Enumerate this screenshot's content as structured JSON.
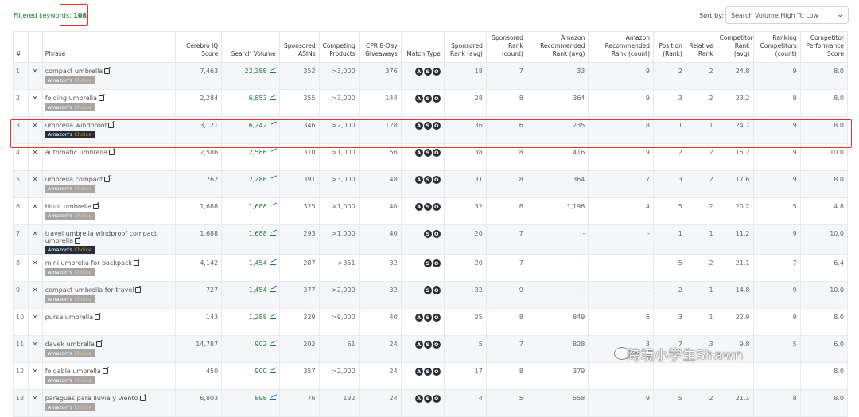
{
  "header": {
    "filtered_label": "Filtered keywords: ",
    "filtered_count": "108",
    "sort_label": "Sort by:",
    "sort_value": "Search Volume High To Low"
  },
  "columns": {
    "num": "#",
    "phrase": "Phrase",
    "cerebro": "Cerebro IQ Score",
    "search_volume": "Search Volume",
    "sponsored_asins": "Sponsored ASINs",
    "competing_products": "Competing Products",
    "cpr": "CPR 8-Day Giveaways",
    "match_type": "Match Type",
    "sponsored_rank_avg": "Sponsored Rank (avg)",
    "sponsored_rank_count": "Sponsored Rank (count)",
    "amazon_rec_rank_avg": "Amazon Recommended Rank (avg)",
    "amazon_rec_rank_count": "Amazon Recommended Rank (count)",
    "position": "Position (Rank)",
    "relative_rank": "Relative Rank",
    "competitor_rank_avg": "Competitor Rank (avg)",
    "ranking_competitors": "Ranking Competitors (count)",
    "competitor_perf": "Competitor Performance Score"
  },
  "badge": {
    "prefix": "Amazon's ",
    "suffix": "Choice"
  },
  "rows": [
    {
      "n": "1",
      "x": "✕",
      "phrase": "compact umbrella",
      "badge": "light",
      "cerebro": "7,463",
      "sv": "22,388",
      "sa": "352",
      "cp": ">3,000",
      "cpr": "376",
      "mt": [
        "A",
        "S",
        "O"
      ],
      "sra": "18",
      "src": "7",
      "ara": "33",
      "arc": "9",
      "pos": "2",
      "rel": "2",
      "cra": "24.8",
      "rc": "9",
      "cps": "8.0"
    },
    {
      "n": "2",
      "x": "✕",
      "phrase": "folding umbrella",
      "badge": "light",
      "cerebro": "2,284",
      "sv": "6,853",
      "sa": "355",
      "cp": ">3,000",
      "cpr": "144",
      "mt": [
        "A",
        "S",
        "O"
      ],
      "sra": "28",
      "src": "8",
      "ara": "364",
      "arc": "9",
      "pos": "3",
      "rel": "2",
      "cra": "23.2",
      "rc": "9",
      "cps": "8.0"
    },
    {
      "n": "3",
      "x": "✕",
      "phrase": "umbrella windproof",
      "badge": "dark",
      "cerebro": "3,121",
      "sv": "6,242",
      "sa": "346",
      "cp": ">2,000",
      "cpr": "128",
      "mt": [
        "A",
        "S",
        "O"
      ],
      "sra": "36",
      "src": "6",
      "ara": "235",
      "arc": "8",
      "pos": "1",
      "rel": "1",
      "cra": "24.7",
      "rc": "9",
      "cps": "8.0"
    },
    {
      "n": "4",
      "x": "✕",
      "phrase": "automatic umbrella",
      "badge": "",
      "cerebro": "2,586",
      "sv": "2,586",
      "sa": "310",
      "cp": ">1,000",
      "cpr": "56",
      "mt": [
        "A",
        "S",
        "O"
      ],
      "sra": "38",
      "src": "8",
      "ara": "416",
      "arc": "9",
      "pos": "2",
      "rel": "2",
      "cra": "15.2",
      "rc": "9",
      "cps": "10.0"
    },
    {
      "n": "5",
      "x": "✕",
      "phrase": "umbrella compact",
      "badge": "light",
      "cerebro": "762",
      "sv": "2,286",
      "sa": "391",
      "cp": ">3,000",
      "cpr": "48",
      "mt": [
        "A",
        "S",
        "O"
      ],
      "sra": "31",
      "src": "8",
      "ara": "364",
      "arc": "7",
      "pos": "3",
      "rel": "2",
      "cra": "17.6",
      "rc": "9",
      "cps": "8.0"
    },
    {
      "n": "6",
      "x": "✕",
      "phrase": "blunt umbrella",
      "badge": "light",
      "cerebro": "1,688",
      "sv": "1,688",
      "sa": "325",
      "cp": ">1,000",
      "cpr": "40",
      "mt": [
        "A",
        "S",
        "O"
      ],
      "sra": "32",
      "src": "6",
      "ara": "1,198",
      "arc": "4",
      "pos": "5",
      "rel": "2",
      "cra": "20.2",
      "rc": "5",
      "cps": "4.8"
    },
    {
      "n": "7",
      "x": "✕",
      "phrase": "travel umbrella windproof compact umbrella",
      "badge": "dark",
      "cerebro": "1,688",
      "sv": "1,688",
      "sa": "293",
      "cp": ">1,000",
      "cpr": "40",
      "mt": [
        "S",
        "O"
      ],
      "sra": "20",
      "src": "7",
      "ara": "-",
      "arc": "-",
      "pos": "1",
      "rel": "1",
      "cra": "11.2",
      "rc": "9",
      "cps": "10.0"
    },
    {
      "n": "8",
      "x": "✕",
      "phrase": "mini umbrella for backpack",
      "badge": "light",
      "cerebro": "4,142",
      "sv": "1,454",
      "sa": "287",
      "cp": ">351",
      "cpr": "32",
      "mt": [
        "S",
        "O"
      ],
      "sra": "20",
      "src": "7",
      "ara": "-",
      "arc": "-",
      "pos": "5",
      "rel": "2",
      "cra": "21.1",
      "rc": "7",
      "cps": "6.4"
    },
    {
      "n": "9",
      "x": "✕",
      "phrase": "compact umbrella for travel",
      "badge": "light",
      "cerebro": "727",
      "sv": "1,454",
      "sa": "377",
      "cp": ">2,000",
      "cpr": "32",
      "mt": [
        "S",
        "O"
      ],
      "sra": "32",
      "src": "9",
      "ara": "-",
      "arc": "-",
      "pos": "2",
      "rel": "1",
      "cra": "14.8",
      "rc": "9",
      "cps": "10.0"
    },
    {
      "n": "10",
      "x": "✕",
      "phrase": "purse umbrella",
      "badge": "",
      "cerebro": "143",
      "sv": "1,288",
      "sa": "329",
      "cp": ">9,000",
      "cpr": "40",
      "mt": [
        "A",
        "S",
        "O"
      ],
      "sra": "25",
      "src": "8",
      "ara": "849",
      "arc": "6",
      "pos": "3",
      "rel": "1",
      "cra": "22.9",
      "rc": "9",
      "cps": "8.0"
    },
    {
      "n": "11",
      "x": "✕",
      "phrase": "davek umbrella",
      "badge": "light",
      "cerebro": "14,787",
      "sv": "902",
      "sa": "202",
      "cp": "61",
      "cpr": "24",
      "mt": [
        "A",
        "S",
        "O"
      ],
      "sra": "5",
      "src": "7",
      "ara": "828",
      "arc": "3",
      "pos": "7",
      "rel": "3",
      "cra": "9.8",
      "rc": "5",
      "cps": "6.0"
    },
    {
      "n": "12",
      "x": "✕",
      "phrase": "foldable umbrella",
      "badge": "light",
      "cerebro": "450",
      "sv": "900",
      "sa": "357",
      "cp": ">2,000",
      "cpr": "24",
      "mt": [
        "A",
        "S",
        "O"
      ],
      "sra": "17",
      "src": "8",
      "ara": "379",
      "arc": "",
      "pos": "",
      "rel": "",
      "cra": "",
      "rc": "",
      "cps": "8.0"
    },
    {
      "n": "13",
      "x": "✕",
      "phrase": "paraguas para lluvia y viento",
      "badge": "light",
      "cerebro": "6,803",
      "sv": "898",
      "sa": "76",
      "cp": "132",
      "cpr": "24",
      "mt": [
        "A",
        "S",
        "O"
      ],
      "sra": "4",
      "src": "5",
      "ara": "558",
      "arc": "9",
      "pos": "5",
      "rel": "2",
      "cra": "21.1",
      "rc": "8",
      "cps": "8.0"
    }
  ],
  "watermark": "跨境小学生Shawn"
}
